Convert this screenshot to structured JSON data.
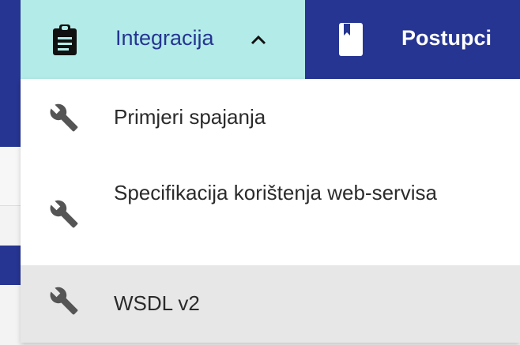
{
  "nav": {
    "integracija": {
      "label": "Integracija",
      "icon": "clipboard-icon",
      "bg": "#b2ebe8"
    },
    "postupci": {
      "label": "Postupci",
      "icon": "bookmark-icon"
    }
  },
  "dropdown": {
    "items": [
      {
        "label": "Primjeri spajanja",
        "icon": "wrench-icon"
      },
      {
        "label": "Specifikacija korištenja web-servisa",
        "icon": "wrench-icon"
      },
      {
        "label": "WSDL v2",
        "icon": "wrench-icon",
        "highlighted": true
      }
    ]
  },
  "colors": {
    "navbar": "#263592",
    "highlight": "#e7e7e7"
  }
}
